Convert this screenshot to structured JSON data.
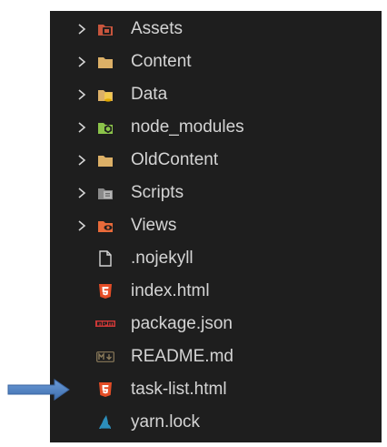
{
  "explorer": {
    "items": [
      {
        "type": "folder",
        "label": "Assets",
        "icon": "folder-assets-icon"
      },
      {
        "type": "folder",
        "label": "Content",
        "icon": "folder-icon"
      },
      {
        "type": "folder",
        "label": "Data",
        "icon": "folder-database-icon"
      },
      {
        "type": "folder",
        "label": "node_modules",
        "icon": "folder-node-icon"
      },
      {
        "type": "folder",
        "label": "OldContent",
        "icon": "folder-icon"
      },
      {
        "type": "folder",
        "label": "Scripts",
        "icon": "folder-scripts-icon"
      },
      {
        "type": "folder",
        "label": "Views",
        "icon": "folder-views-icon"
      },
      {
        "type": "file",
        "label": ".nojekyll",
        "icon": "file-icon"
      },
      {
        "type": "file",
        "label": "index.html",
        "icon": "html5-icon"
      },
      {
        "type": "file",
        "label": "package.json",
        "icon": "npm-icon"
      },
      {
        "type": "file",
        "label": "README.md",
        "icon": "markdown-icon"
      },
      {
        "type": "file",
        "label": "task-list.html",
        "icon": "html5-icon"
      },
      {
        "type": "file",
        "label": "yarn.lock",
        "icon": "yarn-icon"
      }
    ]
  },
  "annotation": {
    "icon": "pointer-arrow-icon",
    "color": "#4a7ebb"
  },
  "colors": {
    "background": "#1e1e1e",
    "text": "#d4d4d4",
    "folder": "#dcb067",
    "html5": "#e44d26",
    "npm": "#cb3837",
    "yarn": "#2c8ebb"
  }
}
